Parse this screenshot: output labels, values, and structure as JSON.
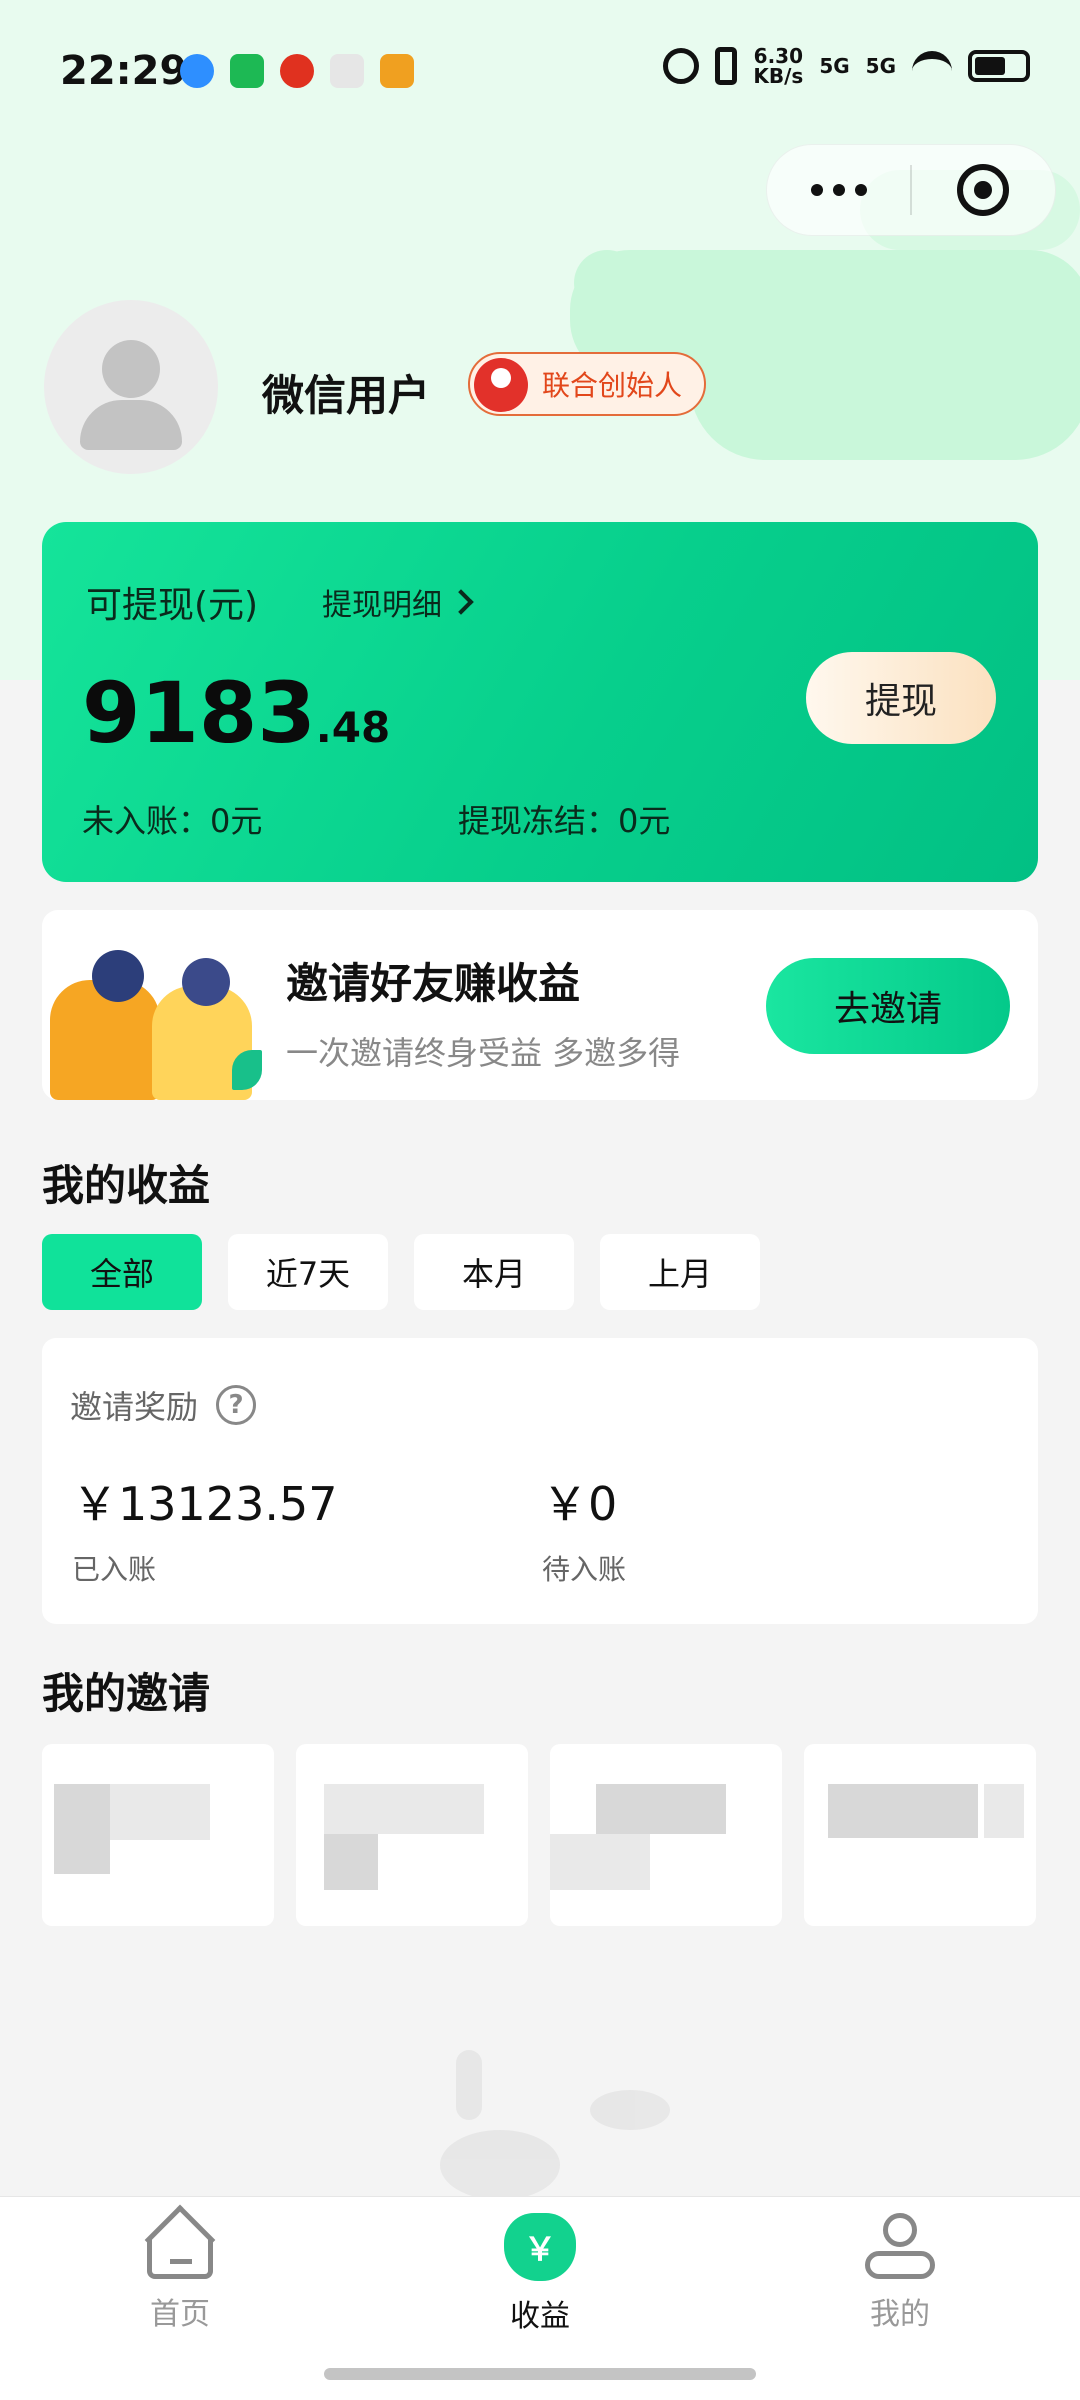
{
  "status_bar": {
    "time": "22:29",
    "net_speed_top": "6.30",
    "net_speed_bottom": "KB/s",
    "sim1": "5G",
    "sim2": "5G"
  },
  "profile": {
    "username": "微信用户",
    "badge": "联合创始人"
  },
  "balance": {
    "label": "可提现(元)",
    "detail_link": "提现明细",
    "amount_int": "9183",
    "amount_dec": ".48",
    "withdraw_button": "提现",
    "pending": "未入账：0元",
    "frozen": "提现冻结：0元"
  },
  "invite_banner": {
    "title": "邀请好友赚收益",
    "subtitle": "一次邀请终身受益 多邀多得",
    "button": "去邀请"
  },
  "earnings": {
    "section_title": "我的收益",
    "tabs": [
      "全部",
      "近7天",
      "本月",
      "上月"
    ],
    "active_tab": "全部",
    "reward_title": "邀请奖励",
    "help_icon": "?",
    "credited_amount": "￥13123.57",
    "credited_label": "已入账",
    "pending_amount": "￥0",
    "pending_label": "待入账"
  },
  "invites": {
    "section_title": "我的邀请"
  },
  "bottom_nav": {
    "home": "首页",
    "earnings": "收益",
    "earnings_icon_glyph": "￥",
    "mine": "我的",
    "active": "收益"
  },
  "colors": {
    "accent": "#10e29a",
    "card_gradient_start": "#15e49a",
    "card_gradient_end": "#02c084",
    "badge_red": "#e2471b"
  }
}
